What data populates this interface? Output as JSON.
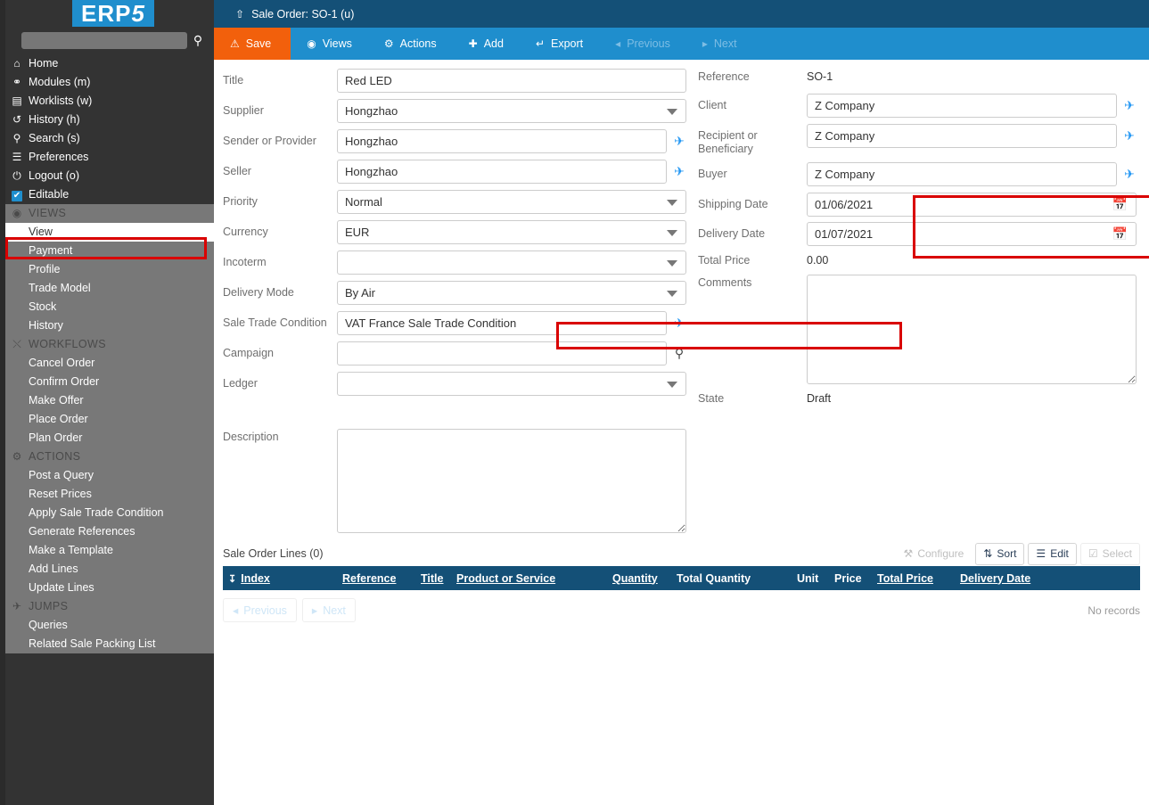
{
  "sidebar": {
    "logo": "ERP5",
    "logo_main": "ERP",
    "logo_accent": "5",
    "search": {
      "value": "",
      "placeholder": "",
      "icon": "search-icon"
    },
    "top_items": [
      {
        "icon": "home-icon",
        "glyph": "⌂",
        "label": "Home"
      },
      {
        "icon": "modules-icon",
        "glyph": "⛭",
        "label": "Modules (m)"
      },
      {
        "icon": "worklists-icon",
        "glyph": "▤",
        "label": "Worklists (w)"
      },
      {
        "icon": "history-icon",
        "glyph": "↺",
        "label": "History (h)"
      },
      {
        "icon": "search-icon",
        "glyph": "⚲",
        "label": "Search (s)"
      },
      {
        "icon": "preferences-icon",
        "glyph": "☰",
        "label": "Preferences"
      },
      {
        "icon": "logout-icon",
        "glyph": "⏻",
        "label": "Logout (o)"
      },
      {
        "icon": "checkbox-icon",
        "glyph": "✔",
        "label": "Editable",
        "checked": true
      }
    ],
    "sections": [
      {
        "name": "views",
        "icon": "eye-icon",
        "glyph": "◉",
        "header": "VIEWS",
        "items": [
          {
            "label": "View",
            "selected": true
          },
          {
            "label": "Payment"
          },
          {
            "label": "Profile"
          },
          {
            "label": "Trade Model"
          },
          {
            "label": "Stock"
          },
          {
            "label": "History"
          }
        ]
      },
      {
        "name": "workflows",
        "icon": "shuffle-icon",
        "glyph": "⤬",
        "header": "WORKFLOWS",
        "items": [
          {
            "label": "Cancel Order"
          },
          {
            "label": "Confirm Order"
          },
          {
            "label": "Make Offer"
          },
          {
            "label": "Place Order"
          },
          {
            "label": "Plan Order"
          }
        ]
      },
      {
        "name": "actions",
        "icon": "gear-icon",
        "glyph": "⚙",
        "header": "ACTIONS",
        "items": [
          {
            "label": "Post a Query"
          },
          {
            "label": "Reset Prices"
          },
          {
            "label": "Apply Sale Trade Condition"
          },
          {
            "label": "Generate References"
          },
          {
            "label": "Make a Template"
          },
          {
            "label": "Add Lines"
          },
          {
            "label": "Update Lines"
          }
        ]
      },
      {
        "name": "jumps",
        "icon": "plane-icon",
        "glyph": "✈",
        "header": "JUMPS",
        "items": [
          {
            "label": "Queries"
          },
          {
            "label": "Related Sale Packing List"
          }
        ]
      }
    ]
  },
  "header": {
    "up_icon": "arrow-up-icon",
    "title": "Sale Order: SO-1 (u)"
  },
  "toolbar": {
    "save": {
      "label": "Save",
      "icon": "warning-triangle-icon",
      "glyph": "⚠"
    },
    "views": {
      "label": "Views",
      "icon": "eye-icon",
      "glyph": "◉"
    },
    "actions": {
      "label": "Actions",
      "icon": "gear-icon",
      "glyph": "⚙"
    },
    "add": {
      "label": "Add",
      "icon": "plus-icon",
      "glyph": "✚"
    },
    "export": {
      "label": "Export",
      "icon": "export-icon",
      "glyph": "↱"
    },
    "previous": {
      "label": "Previous",
      "icon": "chevron-left-icon",
      "glyph": "◂"
    },
    "next": {
      "label": "Next",
      "icon": "chevron-right-icon",
      "glyph": "▸"
    }
  },
  "form": {
    "left": {
      "title": {
        "label": "Title",
        "value": "Red LED"
      },
      "supplier": {
        "label": "Supplier",
        "value": "Hongzhao"
      },
      "sender": {
        "label": "Sender or Provider",
        "value": "Hongzhao"
      },
      "seller": {
        "label": "Seller",
        "value": "Hongzhao"
      },
      "priority": {
        "label": "Priority",
        "value": "Normal"
      },
      "currency": {
        "label": "Currency",
        "value": "EUR"
      },
      "incoterm": {
        "label": "Incoterm",
        "value": ""
      },
      "delivery_mode": {
        "label": "Delivery Mode",
        "value": "By Air"
      },
      "sale_trade_condition": {
        "label": "Sale Trade Condition",
        "value": "VAT France Sale Trade Condition"
      },
      "campaign": {
        "label": "Campaign",
        "value": ""
      },
      "ledger": {
        "label": "Ledger",
        "value": ""
      },
      "description": {
        "label": "Description",
        "value": ""
      }
    },
    "right": {
      "reference": {
        "label": "Reference",
        "value": "SO-1"
      },
      "client": {
        "label": "Client",
        "value": "Z Company"
      },
      "recipient": {
        "label": "Recipient or Beneficiary",
        "value": "Z Company"
      },
      "buyer": {
        "label": "Buyer",
        "value": "Z Company"
      },
      "shipping_date": {
        "label": "Shipping Date",
        "value": "01/06/2021"
      },
      "delivery_date": {
        "label": "Delivery Date",
        "value": "01/07/2021"
      },
      "total_price": {
        "label": "Total Price",
        "value": "0.00"
      },
      "comments": {
        "label": "Comments",
        "value": ""
      },
      "state": {
        "label": "State",
        "value": "Draft"
      }
    }
  },
  "listbox": {
    "title": "Sale Order Lines (0)",
    "buttons": {
      "configure": {
        "label": "Configure",
        "icon": "wrench-icon",
        "glyph": "⚒",
        "disabled": true
      },
      "sort": {
        "label": "Sort",
        "icon": "sort-icon",
        "glyph": "⇵",
        "disabled": false
      },
      "edit": {
        "label": "Edit",
        "icon": "list-icon",
        "glyph": "☰",
        "disabled": false
      },
      "select": {
        "label": "Select",
        "icon": "checkbox-icon",
        "glyph": "☑",
        "disabled": true
      }
    },
    "sort_icon": "sort-asc-icon",
    "columns": [
      {
        "label": "Index",
        "sortable": true
      },
      {
        "label": "Reference",
        "sortable": true
      },
      {
        "label": "Title",
        "sortable": true
      },
      {
        "label": "Product or Service",
        "sortable": true
      },
      {
        "label": "Quantity",
        "sortable": true
      },
      {
        "label": "Total Quantity",
        "sortable": false
      },
      {
        "label": "Unit",
        "sortable": false
      },
      {
        "label": "Price",
        "sortable": false
      },
      {
        "label": "Total Price",
        "sortable": true
      },
      {
        "label": "Delivery Date",
        "sortable": true
      }
    ],
    "rows": [],
    "previous_label": "Previous",
    "next_label": "Next",
    "empty_text": "No records"
  },
  "colors": {
    "accent_blue": "#1f8ecd",
    "dark_blue": "#145077",
    "orange": "#f2600c",
    "sidebar_dark": "#333333",
    "sidebar_grey": "#787878",
    "highlight_red": "#d90000"
  }
}
